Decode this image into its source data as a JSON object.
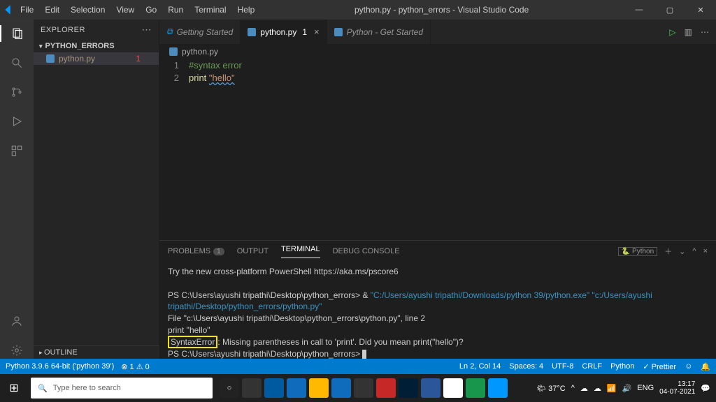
{
  "titlebar": {
    "title": "python.py - python_errors - Visual Studio Code"
  },
  "menu": {
    "items": [
      "File",
      "Edit",
      "Selection",
      "View",
      "Go",
      "Run",
      "Terminal",
      "Help"
    ]
  },
  "sidebar": {
    "title": "EXPLORER",
    "section": "PYTHON_ERRORS",
    "file": "python.py",
    "file_err": "1",
    "outline": "OUTLINE"
  },
  "tabs": {
    "t0": "Getting Started",
    "t1": "python.py",
    "t1_count": "1",
    "t2": "Python - Get Started"
  },
  "crumb": {
    "file": "python.py"
  },
  "code": {
    "l1n": "1",
    "l1": "#syntax error",
    "l2n": "2",
    "l2_a": "print",
    "l2_b": "\"hello\""
  },
  "panel": {
    "problems": "PROBLEMS",
    "problems_badge": "1",
    "output": "OUTPUT",
    "terminal": "TERMINAL",
    "debug": "DEBUG CONSOLE",
    "lang": "Python"
  },
  "term": {
    "l1": "Try the new cross-platform PowerShell https://aka.ms/pscore6",
    "l2a": "PS C:\\Users\\ayushi tripathi\\Desktop\\python_errors> & ",
    "l2b": "\"C:/Users/ayushi tripathi/Downloads/python 39/python.exe\" \"c:/Users/ayushi tripathi/Desktop/python_errors/python.py\"",
    "l3": "  File \"c:\\Users\\ayushi tripathi\\Desktop\\python_errors\\python.py\", line 2",
    "l4": "    print \"hello\"",
    "l5a": "SyntaxError",
    "l5b": ": Missing parentheses in call to 'print'. Did you mean print(\"hello\")?",
    "l6": "PS C:\\Users\\ayushi tripathi\\Desktop\\python_errors> "
  },
  "status": {
    "py": "Python 3.9.6 64-bit ('python 39')",
    "errs": "⊗ 1  ⚠ 0",
    "lncol": "Ln 2, Col 14",
    "spaces": "Spaces: 4",
    "enc": "UTF-8",
    "eol": "CRLF",
    "lang": "Python",
    "prettier": "✓ Prettier",
    "bell": "🔔"
  },
  "task": {
    "search": "Type here to search",
    "temp": "🌤 37°C",
    "lang": "ENG",
    "time": "13:17",
    "date": "04-07-2021"
  }
}
